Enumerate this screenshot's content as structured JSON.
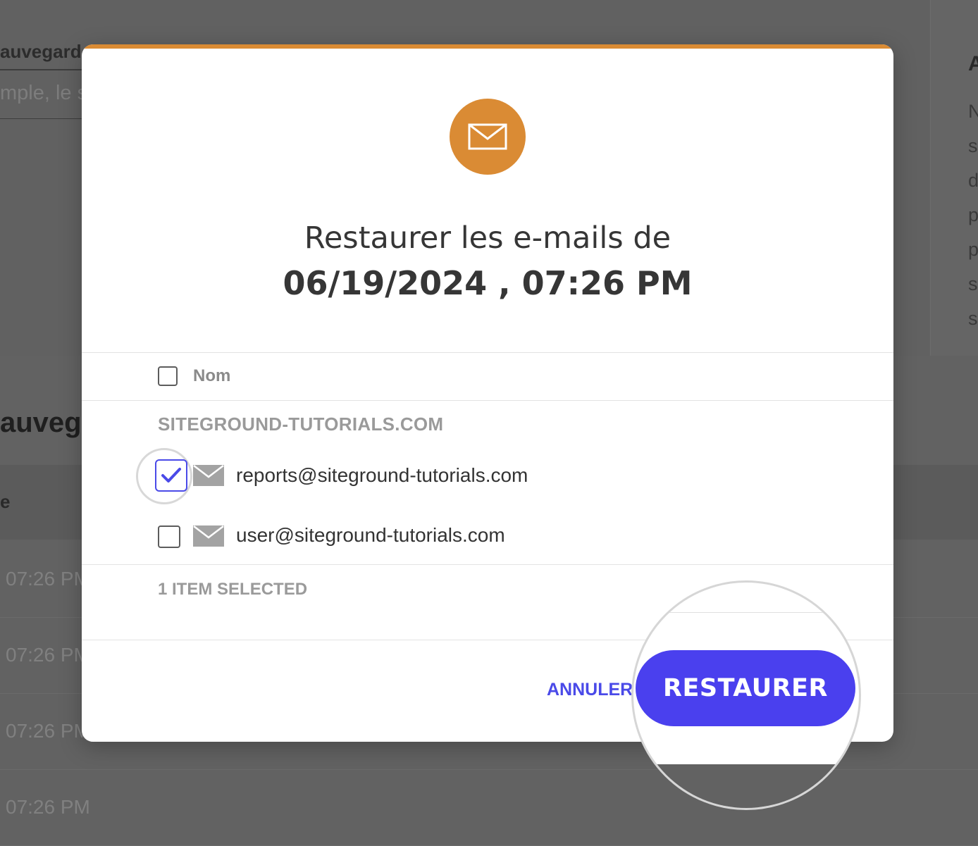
{
  "background": {
    "field_label": "auvegard",
    "field_placeholder": "mple, le s",
    "right_heading": "A",
    "right_text_lines": [
      "N",
      "s",
      "d",
      "p",
      "p",
      "s",
      "s"
    ],
    "section_title": "auveg",
    "table_header": "e",
    "rows": [
      "07:26 PM",
      "07:26 PM",
      "07:26 PM",
      "07:26 PM"
    ]
  },
  "modal": {
    "icon": "envelope-icon",
    "accent_color": "#da8b34",
    "title_line1": "Restaurer les e-mails de",
    "title_line2": "06/19/2024 , 07:26 PM",
    "column_header": "Nom",
    "domain": "SITEGROUND-TUTORIALS.COM",
    "accounts": [
      {
        "email": "reports@siteground-tutorials.com",
        "checked": true
      },
      {
        "email": "user@siteground-tutorials.com",
        "checked": false
      }
    ],
    "selected_count": "1 ITEM SELECTED",
    "cancel_label": "ANNULER",
    "restore_label": "RESTAURER",
    "primary_color": "#4a40ee"
  }
}
